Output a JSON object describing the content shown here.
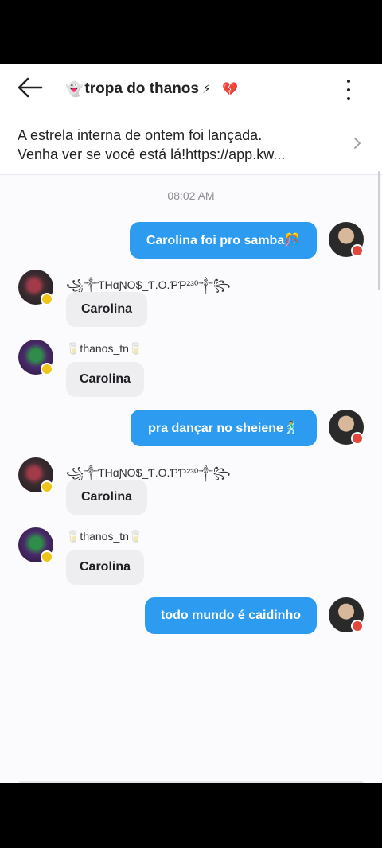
{
  "header": {
    "title_emoji": "👻",
    "title": "tropa do thanos",
    "title_bolt": "⚡",
    "title_heart": "💔",
    "back_icon": "arrow-left-icon",
    "menu_icon": "more-vertical-icon"
  },
  "banner": {
    "line1": "A estrela interna de ontem foi lançada.",
    "line2": "Venha ver se você está lá!https://app.kw..."
  },
  "chat": {
    "timestamp": "08:02 AM",
    "messages": [
      {
        "direction": "out",
        "text": "Carolina foi pro samba🎊"
      },
      {
        "direction": "in",
        "sender": "꧁༒ƬHɑƝO$_Ƭ.O.ƤƤ²³⁰༒꧂",
        "text": "Carolina"
      },
      {
        "direction": "in",
        "sender": "🥛thanos_tn🥛",
        "text": "Carolina"
      },
      {
        "direction": "out",
        "text": "pra dançar no sheiene🕺"
      },
      {
        "direction": "in",
        "sender": "꧁༒ƬHɑƝO$_Ƭ.O.ƤƤ²³⁰༒꧂",
        "text": "Carolina"
      },
      {
        "direction": "in",
        "sender": "🥛thanos_tn🥛",
        "text": "Carolina"
      },
      {
        "direction": "out",
        "text": "todo mundo é caidinho"
      }
    ]
  },
  "colors": {
    "outgoing_bubble": "#2c9bf0",
    "incoming_bubble": "#eeeef1",
    "background": "#fbfbfd"
  }
}
